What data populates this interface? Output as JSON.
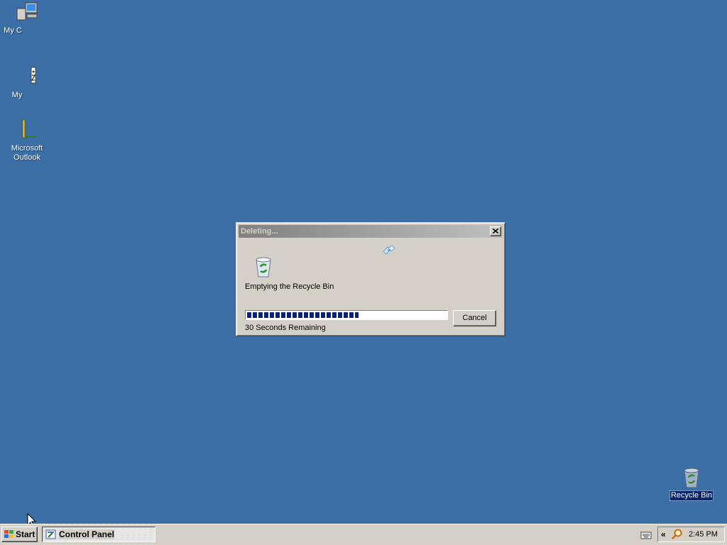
{
  "desktop": {
    "icons": [
      {
        "label": "My C",
        "icon": "my-computer-icon"
      },
      {
        "label": "My",
        "icon": "my-documents-icon"
      },
      {
        "label": "Microsoft Outlook",
        "icon": "outlook-icon"
      },
      {
        "label": "Recycle Bin",
        "icon": "recycle-bin-icon",
        "selected": true
      }
    ],
    "background_color": "#3a6ea5"
  },
  "dialog": {
    "title": "Deleting...",
    "message": "Emptying the Recycle Bin",
    "progress_fraction": 0.56,
    "remaining": "30 Seconds Remaining",
    "cancel_label": "Cancel",
    "icons": [
      "flying-papers-icon",
      "recycle-bin-icon",
      "close-icon"
    ]
  },
  "taskbar": {
    "start_label": "Start",
    "tasks": [
      {
        "label": "Control Panel",
        "icon": "control-panel-icon"
      }
    ],
    "tray": {
      "chevron": "«",
      "clock": "2:45 PM",
      "icons": [
        "keyboard-icon",
        "search-icon"
      ]
    }
  },
  "colors": {
    "progress": "#0a246a",
    "title_inactive_start": "#808080",
    "title_inactive_end": "#c0c0c0",
    "face": "#d4d0c8"
  }
}
